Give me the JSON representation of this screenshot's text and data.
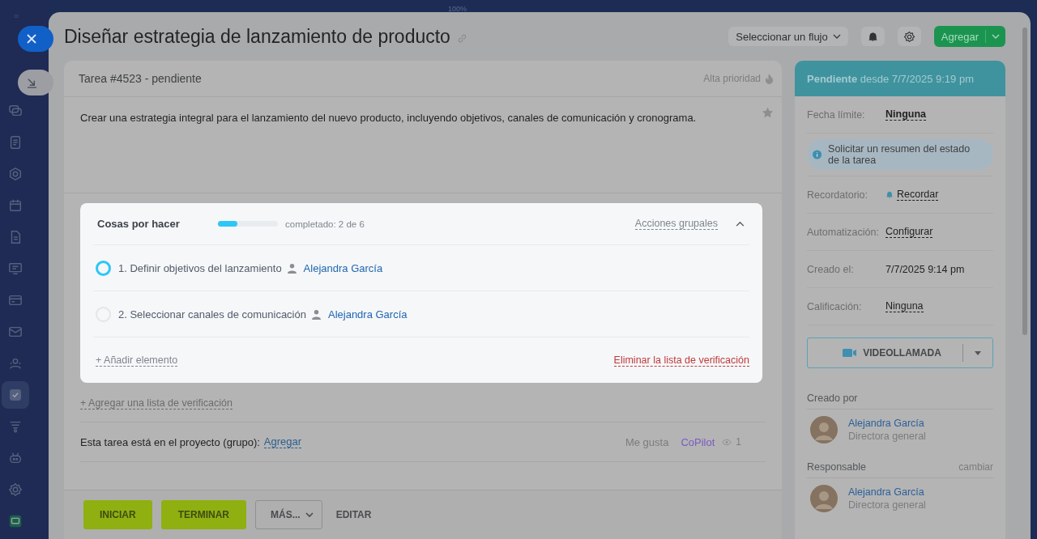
{
  "zoom_label": "100%",
  "sidebar": {
    "items": [
      {
        "kind": "chat",
        "selected": false
      },
      {
        "kind": "document",
        "selected": false
      },
      {
        "kind": "shield",
        "selected": false
      },
      {
        "kind": "calendar",
        "selected": false
      },
      {
        "kind": "file",
        "selected": false
      },
      {
        "kind": "monitor",
        "selected": false
      },
      {
        "kind": "card",
        "selected": false
      },
      {
        "kind": "mail",
        "selected": false
      },
      {
        "kind": "people",
        "selected": false
      },
      {
        "kind": "tasks",
        "selected": true
      },
      {
        "kind": "filter",
        "selected": false
      },
      {
        "kind": "robot",
        "selected": false
      },
      {
        "kind": "settings",
        "selected": false
      },
      {
        "kind": "app",
        "selected": false
      }
    ]
  },
  "header": {
    "title": "Diseñar estrategia de lanzamiento de producto",
    "flow_select": "Seleccionar un flujo",
    "add_button": "Agregar"
  },
  "task": {
    "number_status": "Tarea #4523 - pendiente",
    "priority": "Alta prioridad",
    "description": "Crear una estrategia integral para el lanzamiento del nuevo producto, incluyendo objetivos, canales de comunicación y cronograma.",
    "checklist": {
      "title": "Cosas por hacer",
      "level": 0.33,
      "progress_text": "completado: 2 de 6",
      "group_actions": "Acciones grupales",
      "expanded": true,
      "items": [
        {
          "label": "1. Definir objetivos del lanzamiento",
          "assignee": "Alejandra García",
          "checked": false,
          "focused": true
        },
        {
          "label": "2. Seleccionar canales de comunicación",
          "assignee": "Alejandra García",
          "checked": false,
          "focused": false
        }
      ],
      "add_item": "+ Añadir elemento",
      "delete_list": "Eliminar la lista de verificación"
    },
    "add_checklist": "+ Agregar una lista de verificación",
    "project_text": "Esta tarea está en el proyecto (grupo):",
    "project_link": "Agregar",
    "like": "Me gusta",
    "copilot": "CoPilot",
    "views": "1"
  },
  "actions": {
    "start": "INICIAR",
    "finish": "TERMINAR",
    "more": "MÁS...",
    "edit": "EDITAR"
  },
  "status_panel": {
    "status": "Pendiente",
    "since": "desde 7/7/2025 9:19 pm",
    "fields": [
      {
        "kind": "link",
        "label": "Fecha límite:",
        "value": "Ninguna"
      },
      {
        "kind": "info",
        "value": "Solicitar un resumen del estado de la tarea"
      },
      {
        "kind": "reminder",
        "label": "Recordatorio:",
        "value": "Recordar"
      },
      {
        "kind": "link",
        "label": "Automatización:",
        "value": "Configurar"
      },
      {
        "kind": "text",
        "label": "Creado el:",
        "value": "7/7/2025 9:14 pm"
      },
      {
        "kind": "link",
        "label": "Calificación:",
        "value": "Ninguna"
      }
    ],
    "video_call": "VIDEOLLAMADA",
    "people": [
      {
        "section": "Creado por",
        "name": "Alejandra García",
        "role": "Directora general"
      },
      {
        "section": "Responsable",
        "action": "cambiar",
        "name": "Alejandra García",
        "role": "Directora general"
      }
    ]
  }
}
